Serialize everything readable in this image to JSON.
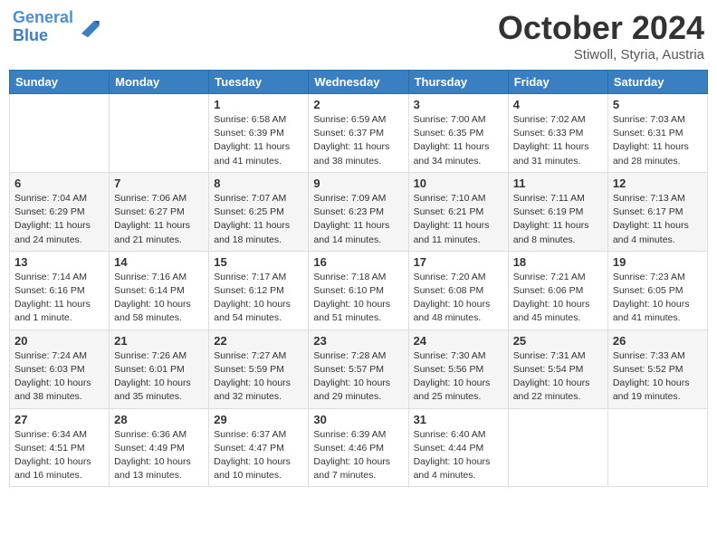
{
  "header": {
    "logo_line1": "General",
    "logo_line2": "Blue",
    "month": "October 2024",
    "location": "Stiwoll, Styria, Austria"
  },
  "days_of_week": [
    "Sunday",
    "Monday",
    "Tuesday",
    "Wednesday",
    "Thursday",
    "Friday",
    "Saturday"
  ],
  "weeks": [
    [
      {
        "day": "",
        "info": ""
      },
      {
        "day": "",
        "info": ""
      },
      {
        "day": "1",
        "info": "Sunrise: 6:58 AM\nSunset: 6:39 PM\nDaylight: 11 hours and 41 minutes."
      },
      {
        "day": "2",
        "info": "Sunrise: 6:59 AM\nSunset: 6:37 PM\nDaylight: 11 hours and 38 minutes."
      },
      {
        "day": "3",
        "info": "Sunrise: 7:00 AM\nSunset: 6:35 PM\nDaylight: 11 hours and 34 minutes."
      },
      {
        "day": "4",
        "info": "Sunrise: 7:02 AM\nSunset: 6:33 PM\nDaylight: 11 hours and 31 minutes."
      },
      {
        "day": "5",
        "info": "Sunrise: 7:03 AM\nSunset: 6:31 PM\nDaylight: 11 hours and 28 minutes."
      }
    ],
    [
      {
        "day": "6",
        "info": "Sunrise: 7:04 AM\nSunset: 6:29 PM\nDaylight: 11 hours and 24 minutes."
      },
      {
        "day": "7",
        "info": "Sunrise: 7:06 AM\nSunset: 6:27 PM\nDaylight: 11 hours and 21 minutes."
      },
      {
        "day": "8",
        "info": "Sunrise: 7:07 AM\nSunset: 6:25 PM\nDaylight: 11 hours and 18 minutes."
      },
      {
        "day": "9",
        "info": "Sunrise: 7:09 AM\nSunset: 6:23 PM\nDaylight: 11 hours and 14 minutes."
      },
      {
        "day": "10",
        "info": "Sunrise: 7:10 AM\nSunset: 6:21 PM\nDaylight: 11 hours and 11 minutes."
      },
      {
        "day": "11",
        "info": "Sunrise: 7:11 AM\nSunset: 6:19 PM\nDaylight: 11 hours and 8 minutes."
      },
      {
        "day": "12",
        "info": "Sunrise: 7:13 AM\nSunset: 6:17 PM\nDaylight: 11 hours and 4 minutes."
      }
    ],
    [
      {
        "day": "13",
        "info": "Sunrise: 7:14 AM\nSunset: 6:16 PM\nDaylight: 11 hours and 1 minute."
      },
      {
        "day": "14",
        "info": "Sunrise: 7:16 AM\nSunset: 6:14 PM\nDaylight: 10 hours and 58 minutes."
      },
      {
        "day": "15",
        "info": "Sunrise: 7:17 AM\nSunset: 6:12 PM\nDaylight: 10 hours and 54 minutes."
      },
      {
        "day": "16",
        "info": "Sunrise: 7:18 AM\nSunset: 6:10 PM\nDaylight: 10 hours and 51 minutes."
      },
      {
        "day": "17",
        "info": "Sunrise: 7:20 AM\nSunset: 6:08 PM\nDaylight: 10 hours and 48 minutes."
      },
      {
        "day": "18",
        "info": "Sunrise: 7:21 AM\nSunset: 6:06 PM\nDaylight: 10 hours and 45 minutes."
      },
      {
        "day": "19",
        "info": "Sunrise: 7:23 AM\nSunset: 6:05 PM\nDaylight: 10 hours and 41 minutes."
      }
    ],
    [
      {
        "day": "20",
        "info": "Sunrise: 7:24 AM\nSunset: 6:03 PM\nDaylight: 10 hours and 38 minutes."
      },
      {
        "day": "21",
        "info": "Sunrise: 7:26 AM\nSunset: 6:01 PM\nDaylight: 10 hours and 35 minutes."
      },
      {
        "day": "22",
        "info": "Sunrise: 7:27 AM\nSunset: 5:59 PM\nDaylight: 10 hours and 32 minutes."
      },
      {
        "day": "23",
        "info": "Sunrise: 7:28 AM\nSunset: 5:57 PM\nDaylight: 10 hours and 29 minutes."
      },
      {
        "day": "24",
        "info": "Sunrise: 7:30 AM\nSunset: 5:56 PM\nDaylight: 10 hours and 25 minutes."
      },
      {
        "day": "25",
        "info": "Sunrise: 7:31 AM\nSunset: 5:54 PM\nDaylight: 10 hours and 22 minutes."
      },
      {
        "day": "26",
        "info": "Sunrise: 7:33 AM\nSunset: 5:52 PM\nDaylight: 10 hours and 19 minutes."
      }
    ],
    [
      {
        "day": "27",
        "info": "Sunrise: 6:34 AM\nSunset: 4:51 PM\nDaylight: 10 hours and 16 minutes."
      },
      {
        "day": "28",
        "info": "Sunrise: 6:36 AM\nSunset: 4:49 PM\nDaylight: 10 hours and 13 minutes."
      },
      {
        "day": "29",
        "info": "Sunrise: 6:37 AM\nSunset: 4:47 PM\nDaylight: 10 hours and 10 minutes."
      },
      {
        "day": "30",
        "info": "Sunrise: 6:39 AM\nSunset: 4:46 PM\nDaylight: 10 hours and 7 minutes."
      },
      {
        "day": "31",
        "info": "Sunrise: 6:40 AM\nSunset: 4:44 PM\nDaylight: 10 hours and 4 minutes."
      },
      {
        "day": "",
        "info": ""
      },
      {
        "day": "",
        "info": ""
      }
    ]
  ]
}
